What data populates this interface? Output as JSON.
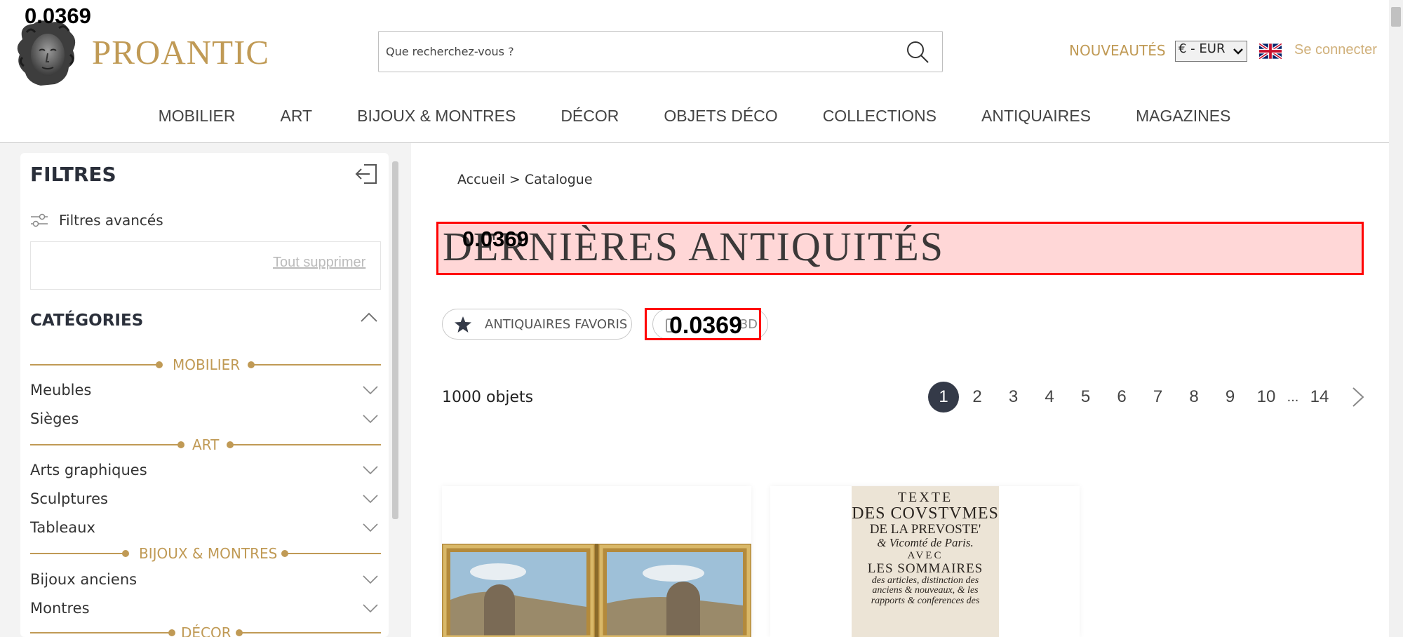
{
  "overlay": {
    "score_value": "0.0369"
  },
  "header": {
    "brand": "PROANTIC",
    "search_placeholder": "Que recherchez-vous ?",
    "new_link": "NOUVEAUTÉS",
    "currency_selected": "€ - EUR",
    "login_link": "Se connecter",
    "accent_color": "#c09a55"
  },
  "nav": [
    "MOBILIER",
    "ART",
    "BIJOUX & MONTRES",
    "DÉCOR",
    "OBJETS DÉCO",
    "COLLECTIONS",
    "ANTIQUAIRES",
    "MAGAZINES"
  ],
  "sidebar": {
    "title": "FILTRES",
    "advanced_filters": "Filtres avancés",
    "clear_all": "Tout supprimer",
    "categories_title": "CATÉGORIES",
    "sections": [
      {
        "label": "MOBILIER",
        "items": [
          "Meubles",
          "Sièges"
        ]
      },
      {
        "label": "ART",
        "items": [
          "Arts graphiques",
          "Sculptures",
          "Tableaux"
        ]
      },
      {
        "label": "BIJOUX & MONTRES",
        "items": [
          "Bijoux anciens",
          "Montres"
        ]
      },
      {
        "label": "DÉCOR",
        "items": []
      }
    ]
  },
  "main": {
    "breadcrumb": "Accueil > Catalogue",
    "title": "DERNIÈRES ANTIQUITÉS",
    "fav_button": "ANTIQUAIRES FAVORIS",
    "second_button_visible": "3D",
    "count": "1000 objets",
    "pages": [
      "1",
      "2",
      "3",
      "4",
      "5",
      "6",
      "7",
      "8",
      "9",
      "10",
      "...",
      "14"
    ],
    "current_page": "1"
  },
  "products": {
    "book_lines": [
      "TEXTE",
      "DES COVSTVMES",
      "DE LA PREVOSTE'",
      "& Vicomté de Paris.",
      "AVEC",
      "LES SOMMAIRES",
      "des articles, distinction des",
      "anciens & nouveaux, & les",
      "rapports & conferences des"
    ]
  }
}
